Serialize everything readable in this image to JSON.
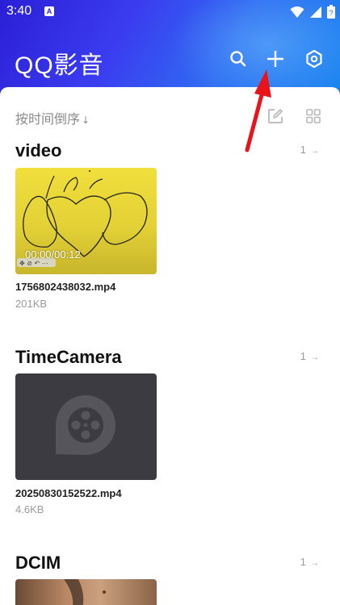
{
  "status_bar": {
    "time": "3:40",
    "notification_badge": "A",
    "icons": [
      "wifi-icon",
      "cellular-signal-icon",
      "battery-icon"
    ]
  },
  "app_bar": {
    "title": "QQ影音",
    "actions": [
      "search-icon",
      "plus-icon",
      "settings-hexagon-icon"
    ]
  },
  "toolbar": {
    "sort_label": "按时间倒序",
    "sort_arrow": "↓",
    "icons": [
      "edit-icon",
      "grid-view-icon"
    ]
  },
  "folders": [
    {
      "name": "video",
      "count": "1",
      "count_arrow": "→",
      "file": {
        "name": "1756802438032.mp4",
        "size": "201KB",
        "thumbnail_overlay_time": "00:00/00:12"
      }
    },
    {
      "name": "TimeCamera",
      "count": "1",
      "count_arrow": "→",
      "file": {
        "name": "20250830152522.mp4",
        "size": "4.6KB"
      }
    },
    {
      "name": "DCIM",
      "count": "1",
      "count_arrow": "→"
    }
  ],
  "colors": {
    "header_gradient_start": "#2a1fd6",
    "header_gradient_end": "#1a86f0",
    "annotation_arrow": "#e8141a",
    "placeholder_thumb": "#3c3b42",
    "yellow_thumb": "#e6d63a"
  }
}
